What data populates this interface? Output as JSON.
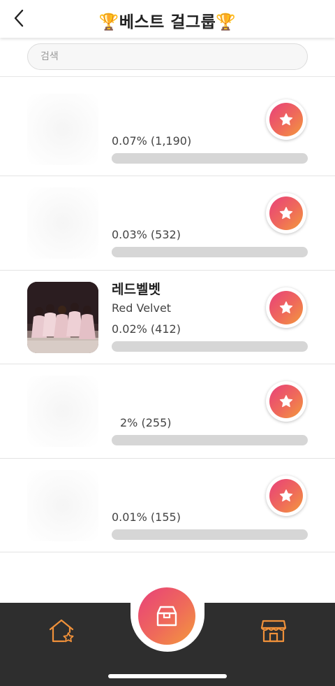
{
  "header": {
    "title": "🏆베스트 걸그룹🏆",
    "back_icon": "chevron-left-icon"
  },
  "search": {
    "placeholder": "검색",
    "value": ""
  },
  "rows": [
    {
      "name": "",
      "subtitle": "",
      "stat": "0.07% (1,190)",
      "percent": 0.07,
      "votes": "1,190",
      "faded": true
    },
    {
      "name": "",
      "subtitle": "",
      "stat": "0.03% (532)",
      "percent": 0.03,
      "votes": "532",
      "faded": true
    },
    {
      "name": "레드벨벳",
      "subtitle": "Red Velvet",
      "stat": "0.02% (412)",
      "percent": 0.02,
      "votes": "412",
      "faded": false
    },
    {
      "name": "",
      "subtitle": "",
      "stat": "2% (255)",
      "percent": 0.02,
      "votes": "255",
      "faded": true
    },
    {
      "name": "",
      "subtitle": "",
      "stat": "0.01% (155)",
      "percent": 0.01,
      "votes": "155",
      "faded": true
    }
  ],
  "vote_icon": "star-icon",
  "bottom_nav": {
    "home_icon": "house-star-icon",
    "center_icon": "box-icon",
    "shop_icon": "store-icon"
  },
  "colors": {
    "accent_gradient_start": "#e8407a",
    "accent_gradient_end": "#f39a3c",
    "nav_icon": "#f0913a",
    "bottom_bar": "#2e2e2e",
    "bar_track": "#d6d6d6"
  }
}
